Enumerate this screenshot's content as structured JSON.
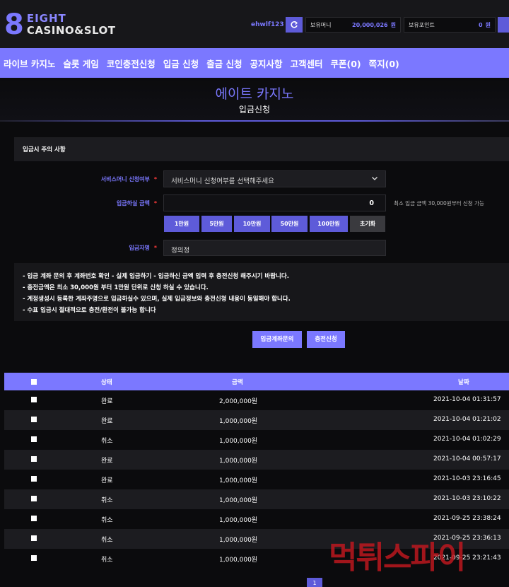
{
  "header": {
    "logo_line1": "EIGHT",
    "logo_line2": "CASINO&SLOT",
    "user_id": "ehwlf123",
    "money_label": "보유머니",
    "money_value": "20,000,026",
    "money_unit": "원",
    "point_label": "보유포인트",
    "point_value": "0",
    "point_unit": "원"
  },
  "nav": [
    "라이브 카지노",
    "슬롯 게임",
    "코인충전신청",
    "입금 신청",
    "출금 신청",
    "공지사항",
    "고객센터",
    "쿠폰(0)",
    "쪽지(0)"
  ],
  "page": {
    "title": "에이트 카지노",
    "subtitle": "입금신청"
  },
  "form": {
    "panel_title": "입금시 주의 사항",
    "service_label": "서비스머니 신청여부",
    "service_placeholder": "서비스머니 신청여부를 선택해주세요",
    "amount_label": "입금하실 금액",
    "amount_value": "0",
    "amount_hint": "최소 입금 금액 30,000원부터 신청 가능",
    "amount_buttons": [
      "1만원",
      "5만원",
      "10만원",
      "50만원",
      "100만원",
      "초기화"
    ],
    "depositor_label": "입금자명",
    "depositor_value": "정의정",
    "required_mark": "*"
  },
  "notes": [
    "- 입금 계좌 문의 후 계좌번호 확인 - 실제 입금하기 - 입금하신 금액 입력 후 충전신청 해주시기 바랍니다.",
    "- 충전금액은 최소 30,000원 부터 1만원 단위로 신청 하실 수 있습니다.",
    "- 계정생성시 등록한 계좌주명으로 입금하실수 있으며, 실제 입금정보와 충전신청 내용이 동일해야 합니다.",
    "- 수표 입금시 절대적으로 충전/환전이 불가능 합니다"
  ],
  "actions": {
    "inquiry": "입금계좌문의",
    "submit": "충전신청"
  },
  "table": {
    "headers": {
      "status": "상태",
      "amount": "금액",
      "date": "날짜"
    },
    "rows": [
      {
        "status": "완료",
        "amount": "2,000,000원",
        "date": "2021-10-04 01:31:57"
      },
      {
        "status": "완료",
        "amount": "1,000,000원",
        "date": "2021-10-04 01:21:02"
      },
      {
        "status": "취소",
        "amount": "1,000,000원",
        "date": "2021-10-04 01:02:29"
      },
      {
        "status": "완료",
        "amount": "1,000,000원",
        "date": "2021-10-04 00:57:17"
      },
      {
        "status": "완료",
        "amount": "1,000,000원",
        "date": "2021-10-03 23:16:45"
      },
      {
        "status": "취소",
        "amount": "1,000,000원",
        "date": "2021-10-03 23:10:22"
      },
      {
        "status": "취소",
        "amount": "1,000,000원",
        "date": "2021-09-25 23:38:24"
      },
      {
        "status": "취소",
        "amount": "1,000,000원",
        "date": "2021-09-25 23:36:13"
      },
      {
        "status": "취소",
        "amount": "1,000,000원",
        "date": "2021-09-25 23:21:43"
      }
    ]
  },
  "pagination": {
    "current": "1"
  },
  "watermark": "먹튀스파이",
  "colors": {
    "accent": "#7b78ff",
    "accent_dark": "#5e5bd9",
    "required": "#ff3b3b",
    "background": "#0b0b0d"
  }
}
